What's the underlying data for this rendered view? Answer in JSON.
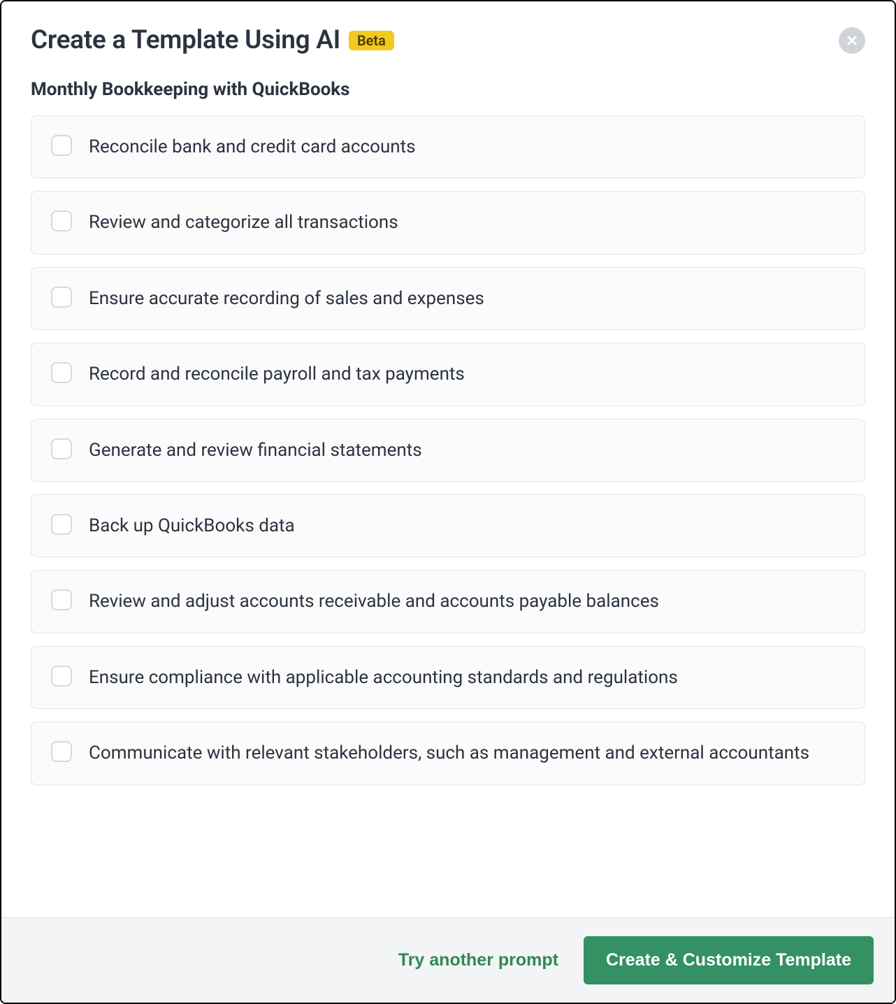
{
  "header": {
    "title": "Create a Template Using AI",
    "badge": "Beta"
  },
  "subtitle": "Monthly Bookkeeping with QuickBooks",
  "tasks": [
    {
      "label": "Reconcile bank and credit card accounts"
    },
    {
      "label": "Review and categorize all transactions"
    },
    {
      "label": "Ensure accurate recording of sales and expenses"
    },
    {
      "label": "Record and reconcile payroll and tax payments"
    },
    {
      "label": "Generate and review financial statements"
    },
    {
      "label": "Back up QuickBooks data"
    },
    {
      "label": "Review and adjust accounts receivable and accounts payable balances"
    },
    {
      "label": "Ensure compliance with applicable accounting standards and regulations"
    },
    {
      "label": "Communicate with relevant stakeholders, such as management and external accountants"
    }
  ],
  "footer": {
    "try_another": "Try another prompt",
    "create": "Create & Customize Template"
  }
}
